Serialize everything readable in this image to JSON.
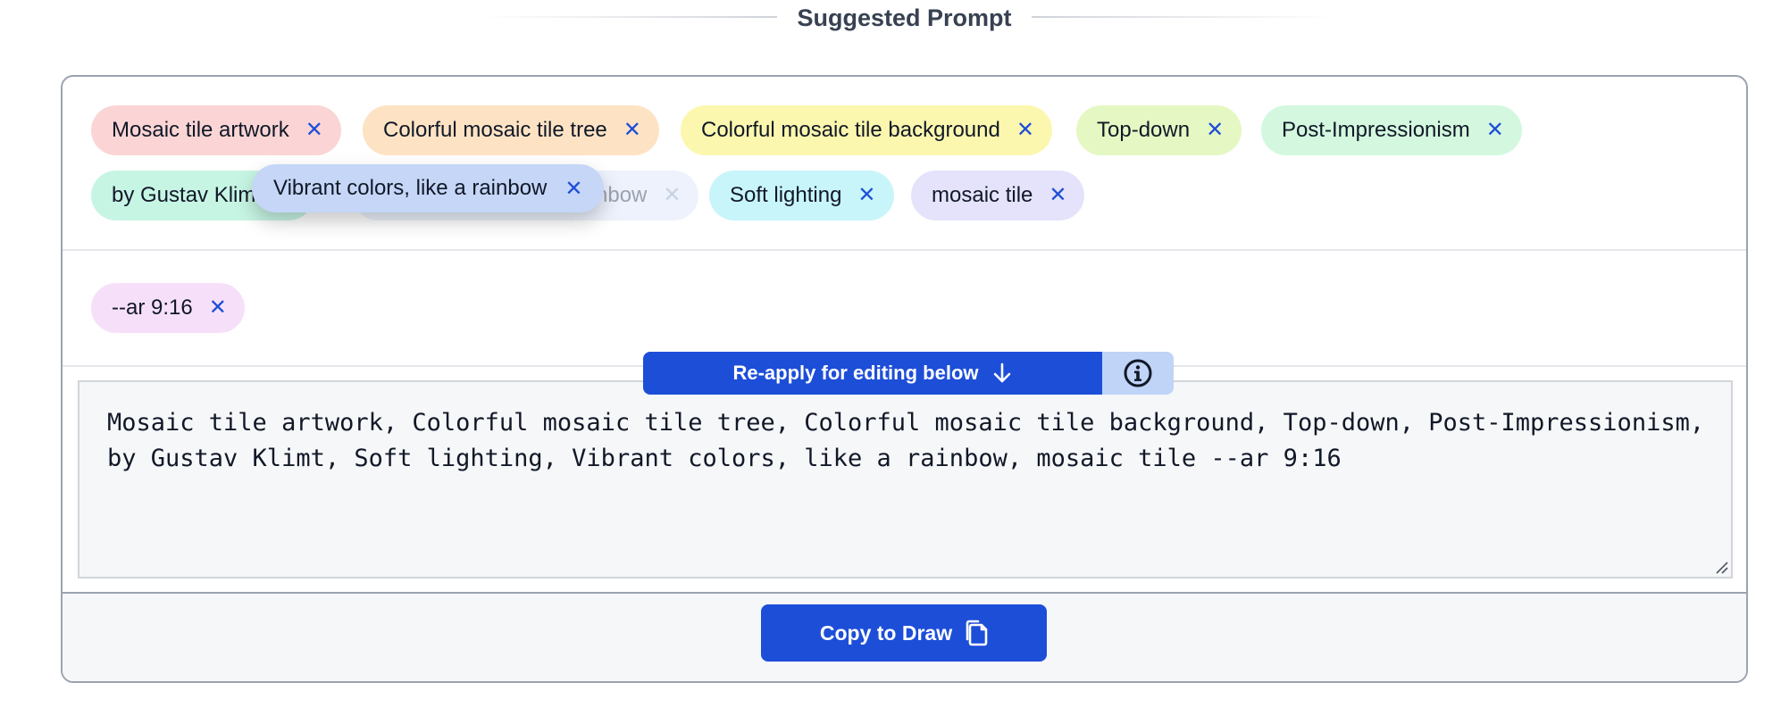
{
  "header": {
    "title": "Suggested Prompt"
  },
  "tags": [
    {
      "label": "Mosaic tile artwork",
      "bg": "#fbd5d5"
    },
    {
      "label": "Colorful mosaic tile tree",
      "bg": "#fde3c4"
    },
    {
      "label": "Colorful mosaic tile background",
      "bg": "#fcf7ae"
    },
    {
      "label": "Top-down",
      "bg": "#e5f8c3"
    },
    {
      "label": "Post-Impressionism",
      "bg": "#d3f8df"
    },
    {
      "label": "by Gustav Klimt",
      "bg": "#c7f5e4"
    },
    {
      "label": "Vibrant colors, like a rainbow",
      "bg": "#edf2fd"
    },
    {
      "label": "Soft lighting",
      "bg": "#c8f5fa"
    },
    {
      "label": "mosaic tile",
      "bg": "#e4e3fb"
    }
  ],
  "param_tags": [
    {
      "label": "--ar 9:16",
      "bg": "#f6e0f9"
    }
  ],
  "drag_ghost": {
    "label": "Vibrant colors, like a rainbow"
  },
  "remove_glyph": "✕",
  "prompt_text": "Mosaic tile artwork, Colorful mosaic tile tree, Colorful mosaic tile background, Top-down, Post-Impressionism, by Gustav Klimt, Soft lighting, Vibrant colors, like a rainbow, mosaic tile --ar 9:16",
  "reapply": {
    "label": "Re-apply for editing below",
    "icon": "arrow-down-icon"
  },
  "info": {
    "icon": "info-icon"
  },
  "copy": {
    "label": "Copy to Draw",
    "icon": "copy-icon"
  },
  "colors": {
    "accent": "#1d4ed8",
    "info_bg": "#bfd4f6",
    "panel_bg": "#f6f7f9"
  }
}
